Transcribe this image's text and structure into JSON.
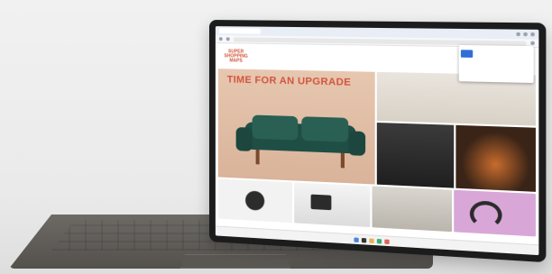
{
  "scene": {
    "subject": "",
    "site_logo_lines": [
      "SUPER",
      "SHOPPING",
      "MAPS"
    ],
    "hero_title": "TIME FOR AN UPGRADE",
    "hero_subtitle": "",
    "popup": {
      "header": "",
      "item_text": ""
    },
    "nav_items": [
      "",
      "",
      "",
      "",
      "",
      ""
    ],
    "colors": {
      "accent": "#d2553d",
      "sofa": "#1f4e45",
      "tablet_frame": "#1c1c1c",
      "keyboard": "#5f5c58",
      "kickstand": "#c8c8c8"
    }
  }
}
